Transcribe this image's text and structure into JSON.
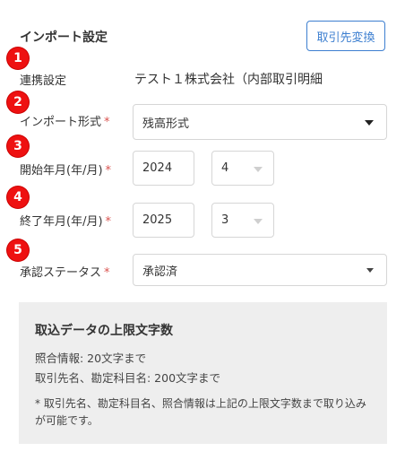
{
  "header": {
    "title": "インポート設定",
    "change_button": "取引先変換"
  },
  "badges": [
    "1",
    "2",
    "3",
    "4",
    "5"
  ],
  "fields": {
    "partner": {
      "label": "連携設定",
      "value": "テスト１株式会社（内部取引明細"
    },
    "import_format": {
      "label": "インポート形式",
      "required_mark": "*",
      "value": "残高形式"
    },
    "start": {
      "label": "開始年月(年/月)",
      "required_mark": "*",
      "year": "2024",
      "month": "4"
    },
    "end": {
      "label": "終了年月(年/月)",
      "required_mark": "*",
      "year": "2025",
      "month": "3"
    },
    "approval_status": {
      "label": "承認ステータス",
      "required_mark": "*",
      "value": "承認済"
    }
  },
  "info": {
    "heading": "取込データの上限文字数",
    "line1": "照合情報: 20文字まで",
    "line2": "取引先名、勘定科目名: 200文字まで",
    "note": "* 取引先名、勘定科目名、照合情報は上記の上限文字数まで取り込みが可能です。"
  },
  "colors": {
    "accent": "#3d7fd0",
    "badge": "#ee1111",
    "required": "#d9534f",
    "info_bg": "#eeeeee"
  }
}
